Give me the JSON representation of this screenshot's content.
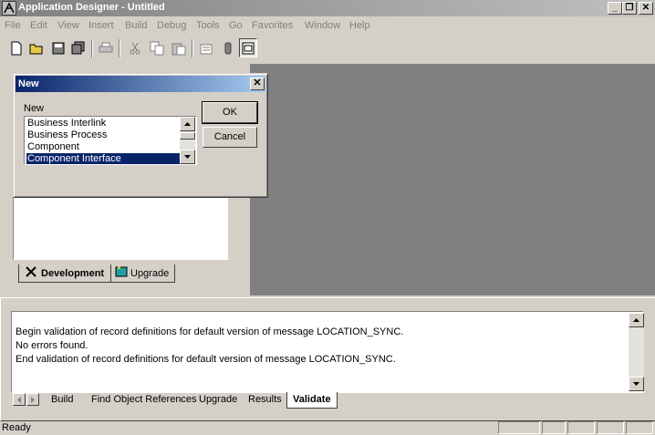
{
  "window": {
    "title": "Application Designer - Untitled"
  },
  "menu": [
    "File",
    "Edit",
    "View",
    "Insert",
    "Build",
    "Debug",
    "Tools",
    "Go",
    "Favorites",
    "Window",
    "Help"
  ],
  "toolbar": {
    "icons": [
      "new-icon",
      "open-icon",
      "save-icon",
      "save-all-icon",
      "print-icon",
      "cut-icon",
      "copy-icon",
      "paste-icon",
      "properties-icon",
      "object-icon",
      "project-window-icon"
    ]
  },
  "project_tabs": {
    "development": "Development",
    "upgrade": "Upgrade"
  },
  "dialog": {
    "title": "New",
    "label": "New",
    "items": [
      "Business Interlink",
      "Business Process",
      "Component",
      "Component Interface"
    ],
    "selected_index": 3,
    "ok_label": "OK",
    "cancel_label": "Cancel",
    "close_glyph": "✕"
  },
  "output": {
    "lines": [
      "Begin validation of record definitions for default version of message LOCATION_SYNC.",
      "No errors found.",
      "End validation of record definitions for default version of message LOCATION_SYNC."
    ],
    "tabs": [
      "Build",
      "Find Object References",
      "Upgrade",
      "Results",
      "Validate"
    ],
    "active_tab": "Validate"
  },
  "status": {
    "text": "Ready"
  },
  "colors": {
    "face": "#d4d0c8",
    "workspace": "#808080",
    "dialog_title": "#0a246a",
    "selection": "#0a246a"
  }
}
